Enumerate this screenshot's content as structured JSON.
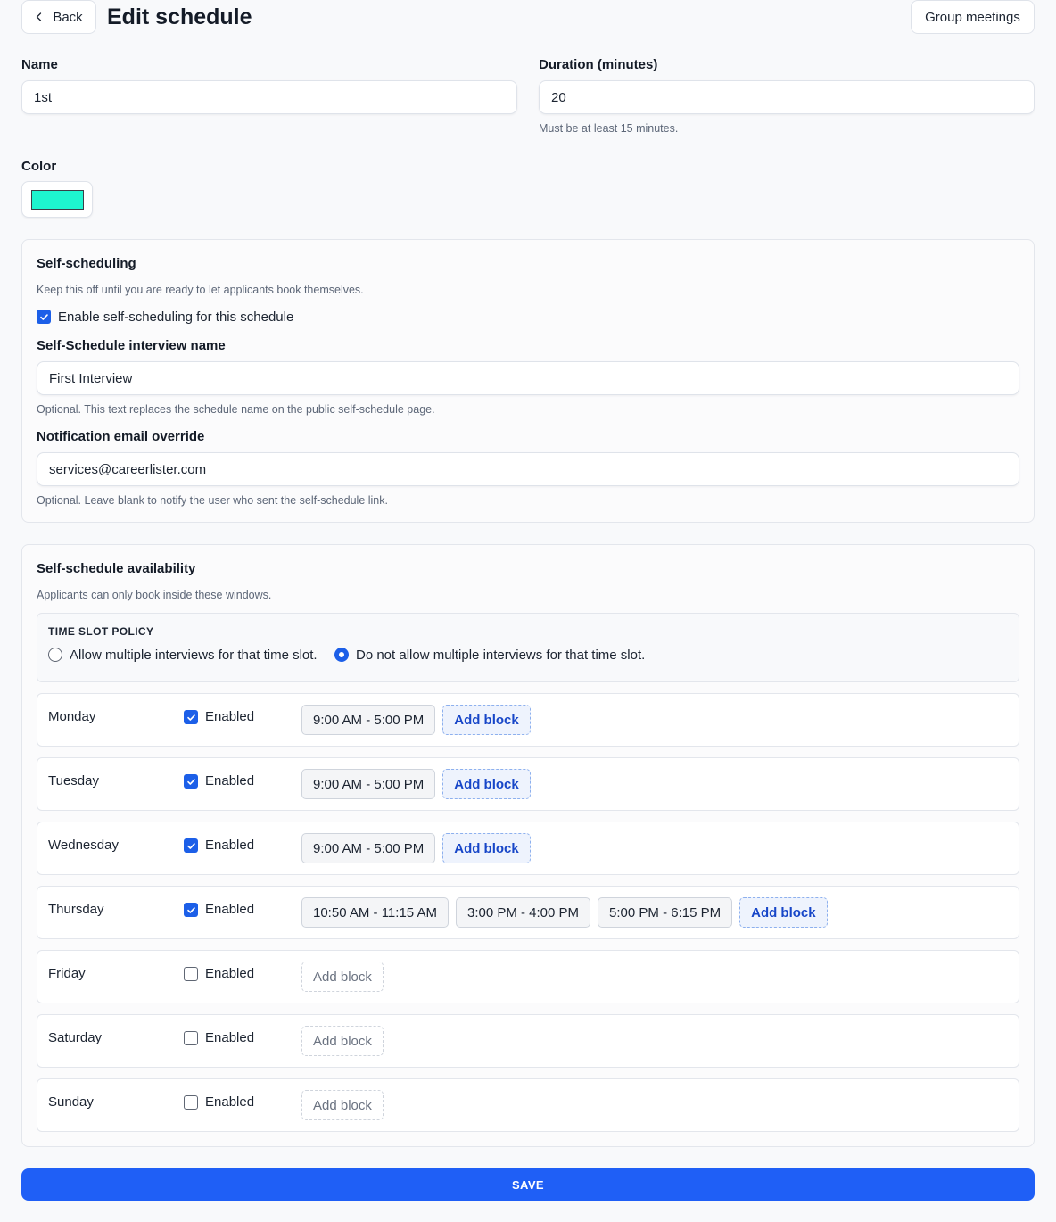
{
  "header": {
    "back_label": "Back",
    "title": "Edit schedule",
    "group_meetings_label": "Group meetings"
  },
  "form": {
    "name_label": "Name",
    "name_value": "1st",
    "duration_label": "Duration (minutes)",
    "duration_value": "20",
    "duration_help": "Must be at least 15 minutes.",
    "color_label": "Color",
    "color_value": "#1ef5cf"
  },
  "self_scheduling": {
    "title": "Self-scheduling",
    "description": "Keep this off until you are ready to let applicants book themselves.",
    "enable_label": "Enable self-scheduling for this schedule",
    "enable_checked": true,
    "interview_name_label": "Self-Schedule interview name",
    "interview_name_value": "First Interview",
    "interview_name_help": "Optional. This text replaces the schedule name on the public self-schedule page.",
    "email_label": "Notification email override",
    "email_value": "services@careerlister.com",
    "email_help": "Optional. Leave blank to notify the user who sent the self-schedule link."
  },
  "availability": {
    "title": "Self-schedule availability",
    "description": "Applicants can only book inside these windows.",
    "policy_title": "TIME SLOT POLICY",
    "policy_options": [
      {
        "label": "Allow multiple interviews for that time slot.",
        "selected": false
      },
      {
        "label": "Do not allow multiple interviews for that time slot.",
        "selected": true
      }
    ],
    "enabled_label": "Enabled",
    "add_block_label": "Add block",
    "days": [
      {
        "name": "Monday",
        "enabled": true,
        "blocks": [
          "9:00 AM - 5:00 PM"
        ]
      },
      {
        "name": "Tuesday",
        "enabled": true,
        "blocks": [
          "9:00 AM - 5:00 PM"
        ]
      },
      {
        "name": "Wednesday",
        "enabled": true,
        "blocks": [
          "9:00 AM - 5:00 PM"
        ]
      },
      {
        "name": "Thursday",
        "enabled": true,
        "blocks": [
          "10:50 AM - 11:15 AM",
          "3:00 PM - 4:00 PM",
          "5:00 PM - 6:15 PM"
        ]
      },
      {
        "name": "Friday",
        "enabled": false,
        "blocks": []
      },
      {
        "name": "Saturday",
        "enabled": false,
        "blocks": []
      },
      {
        "name": "Sunday",
        "enabled": false,
        "blocks": []
      }
    ]
  },
  "save_label": "SAVE",
  "colors": {
    "primary": "#1f5ff6",
    "checkbox": "#1c5fe8",
    "add_block_text": "#1746c8"
  }
}
